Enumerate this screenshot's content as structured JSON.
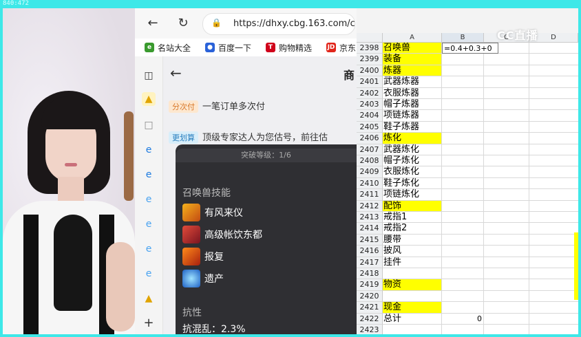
{
  "overlay": {
    "corner_label": "840:472",
    "watermark": "CC直播"
  },
  "browser": {
    "url": "https://dhxy.cbg.163.com/c",
    "bookmarks": [
      {
        "label": "名站大全",
        "color": "#3a9a2e",
        "glyph": "e"
      },
      {
        "label": "百度一下",
        "color": "#2a62d9",
        "glyph": "🐾"
      },
      {
        "label": "购物精选",
        "color": "#d0021b",
        "glyph": "T"
      },
      {
        "label": "京东",
        "color": "#e1251b",
        "glyph": "JD"
      }
    ],
    "page": {
      "title": "商",
      "installment_tag": "分次付",
      "installment_text": "一笔订单多次付",
      "appraise_tag": "更划算",
      "appraise_text": "顶级专家达人为您估号，前往估",
      "breakthrough_level": "突破等级：1/6",
      "skills_title": "召唤兽技能",
      "skills": [
        "有风来仪",
        "高级帐饮东都",
        "报复",
        "遗产"
      ],
      "resist_title": "抗性",
      "resist_item": "抗混乱：2.3%"
    }
  },
  "sheet": {
    "columns": [
      "A",
      "B",
      "C",
      "D"
    ],
    "formula_text": "=0.4+0.3+0",
    "rows": [
      {
        "num": "2398",
        "a": "召唤兽",
        "hl": true,
        "b": ""
      },
      {
        "num": "2399",
        "a": "装备",
        "hl": true,
        "b": ""
      },
      {
        "num": "2400",
        "a": "炼器",
        "hl": true,
        "b": ""
      },
      {
        "num": "2401",
        "a": "武器炼器",
        "hl": false,
        "b": ""
      },
      {
        "num": "2402",
        "a": "衣服炼器",
        "hl": false,
        "b": ""
      },
      {
        "num": "2403",
        "a": "帽子炼器",
        "hl": false,
        "b": ""
      },
      {
        "num": "2404",
        "a": "项链炼器",
        "hl": false,
        "b": ""
      },
      {
        "num": "2405",
        "a": "鞋子炼器",
        "hl": false,
        "b": ""
      },
      {
        "num": "2406",
        "a": "炼化",
        "hl": true,
        "b": ""
      },
      {
        "num": "2407",
        "a": "武器炼化",
        "hl": false,
        "b": ""
      },
      {
        "num": "2408",
        "a": "帽子炼化",
        "hl": false,
        "b": ""
      },
      {
        "num": "2409",
        "a": "衣服炼化",
        "hl": false,
        "b": ""
      },
      {
        "num": "2410",
        "a": "鞋子炼化",
        "hl": false,
        "b": ""
      },
      {
        "num": "2411",
        "a": "项链炼化",
        "hl": false,
        "b": ""
      },
      {
        "num": "2412",
        "a": "配饰",
        "hl": true,
        "b": ""
      },
      {
        "num": "2413",
        "a": "戒指1",
        "hl": false,
        "b": ""
      },
      {
        "num": "2414",
        "a": "戒指2",
        "hl": false,
        "b": ""
      },
      {
        "num": "2415",
        "a": "腰带",
        "hl": false,
        "b": ""
      },
      {
        "num": "2416",
        "a": "披风",
        "hl": false,
        "b": ""
      },
      {
        "num": "2417",
        "a": "挂件",
        "hl": false,
        "b": ""
      },
      {
        "num": "2418",
        "a": "",
        "hl": false,
        "b": ""
      },
      {
        "num": "2419",
        "a": "物资",
        "hl": true,
        "b": ""
      },
      {
        "num": "2420",
        "a": "",
        "hl": false,
        "b": ""
      },
      {
        "num": "2421",
        "a": "现金",
        "hl": true,
        "b": ""
      },
      {
        "num": "2422",
        "a": "总计",
        "hl": false,
        "b": "0"
      },
      {
        "num": "2423",
        "a": "",
        "hl": false,
        "b": ""
      }
    ]
  },
  "colors": {
    "highlight": "#ffff00",
    "border_cyan": "#3ee8e8"
  }
}
